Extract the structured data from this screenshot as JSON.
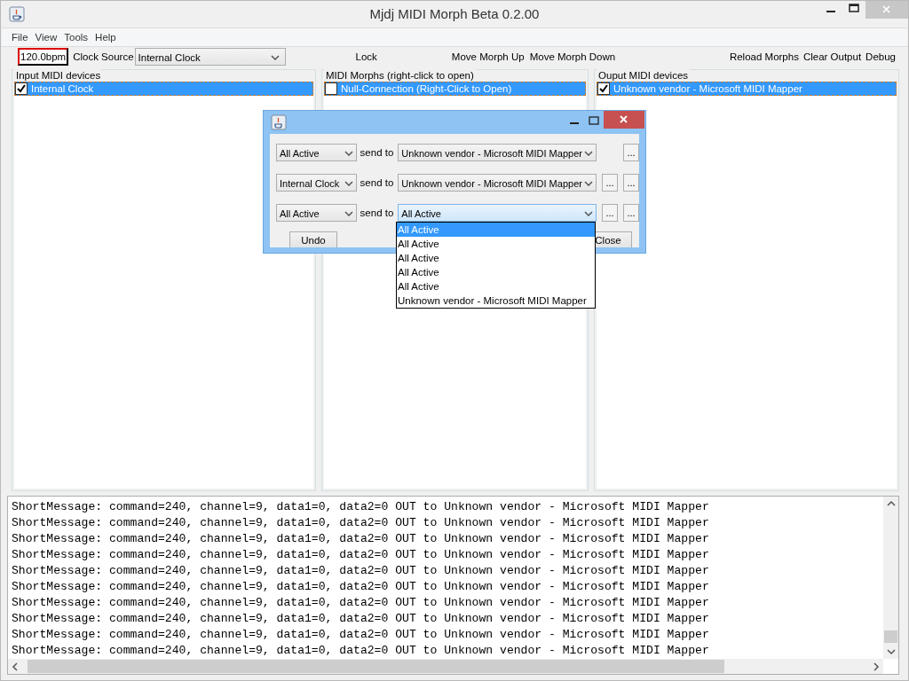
{
  "window": {
    "title": "Mjdj MIDI Morph Beta 0.2.00"
  },
  "menu": [
    "File",
    "View",
    "Tools",
    "Help"
  ],
  "toolbar": {
    "bpm": "120.0bpm",
    "clock_label": "Clock Source",
    "clock_source": "Internal Clock",
    "buttons_left": [
      "Lock",
      "Move Morph Up",
      "Move Morph Down"
    ],
    "buttons_right": [
      "Reload Morphs",
      "Clear Output",
      "Debug"
    ]
  },
  "panels": [
    {
      "title": "Input MIDI devices",
      "items": [
        {
          "label": "Internal Clock",
          "checked": true,
          "selected": true
        }
      ]
    },
    {
      "title": "MIDI Morphs (right-click to open)",
      "items": [
        {
          "label": "Null-Connection (Right-Click to Open)",
          "checked": false,
          "selected": true
        }
      ]
    },
    {
      "title": "Ouput MIDI devices",
      "items": [
        {
          "label": "Unknown vendor - Microsoft MIDI Mapper",
          "checked": true,
          "selected": true
        }
      ]
    }
  ],
  "dialog": {
    "rows": [
      {
        "source": "All Active",
        "send_label": "send to",
        "target": "Unknown vendor - Microsoft MIDI Mapper",
        "focused": false,
        "buttons": [
          "..."
        ]
      },
      {
        "source": "Internal Clock",
        "send_label": "send to",
        "target": "Unknown vendor - Microsoft MIDI Mapper",
        "focused": false,
        "buttons": [
          "...",
          "..."
        ]
      },
      {
        "source": "All Active",
        "send_label": "send to",
        "target": "All Active",
        "focused": true,
        "buttons": [
          "...",
          "..."
        ]
      }
    ],
    "buttons": [
      "Undo",
      "Close"
    ],
    "dropdown": {
      "items": [
        {
          "label": "All Active",
          "selected": true
        },
        {
          "label": "All Active",
          "selected": false
        },
        {
          "label": "All Active",
          "selected": false
        },
        {
          "label": "All Active",
          "selected": false
        },
        {
          "label": "All Active",
          "selected": false
        },
        {
          "label": "Unknown vendor - Microsoft MIDI Mapper",
          "selected": false
        }
      ]
    }
  },
  "log": {
    "lines": [
      "ShortMessage: command=240, channel=9, data1=0, data2=0 OUT to Unknown vendor - Microsoft MIDI Mapper",
      "ShortMessage: command=240, channel=9, data1=0, data2=0 OUT to Unknown vendor - Microsoft MIDI Mapper",
      "ShortMessage: command=240, channel=9, data1=0, data2=0 OUT to Unknown vendor - Microsoft MIDI Mapper",
      "ShortMessage: command=240, channel=9, data1=0, data2=0 OUT to Unknown vendor - Microsoft MIDI Mapper",
      "ShortMessage: command=240, channel=9, data1=0, data2=0 OUT to Unknown vendor - Microsoft MIDI Mapper",
      "ShortMessage: command=240, channel=9, data1=0, data2=0 OUT to Unknown vendor - Microsoft MIDI Mapper",
      "ShortMessage: command=240, channel=9, data1=0, data2=0 OUT to Unknown vendor - Microsoft MIDI Mapper",
      "ShortMessage: command=240, channel=9, data1=0, data2=0 OUT to Unknown vendor - Microsoft MIDI Mapper",
      "ShortMessage: command=240, channel=9, data1=0, data2=0 OUT to Unknown vendor - Microsoft MIDI Mapper",
      "ShortMessage: command=240, channel=9, data1=0, data2=0 OUT to Unknown vendor - Microsoft MIDI Mapper"
    ]
  }
}
